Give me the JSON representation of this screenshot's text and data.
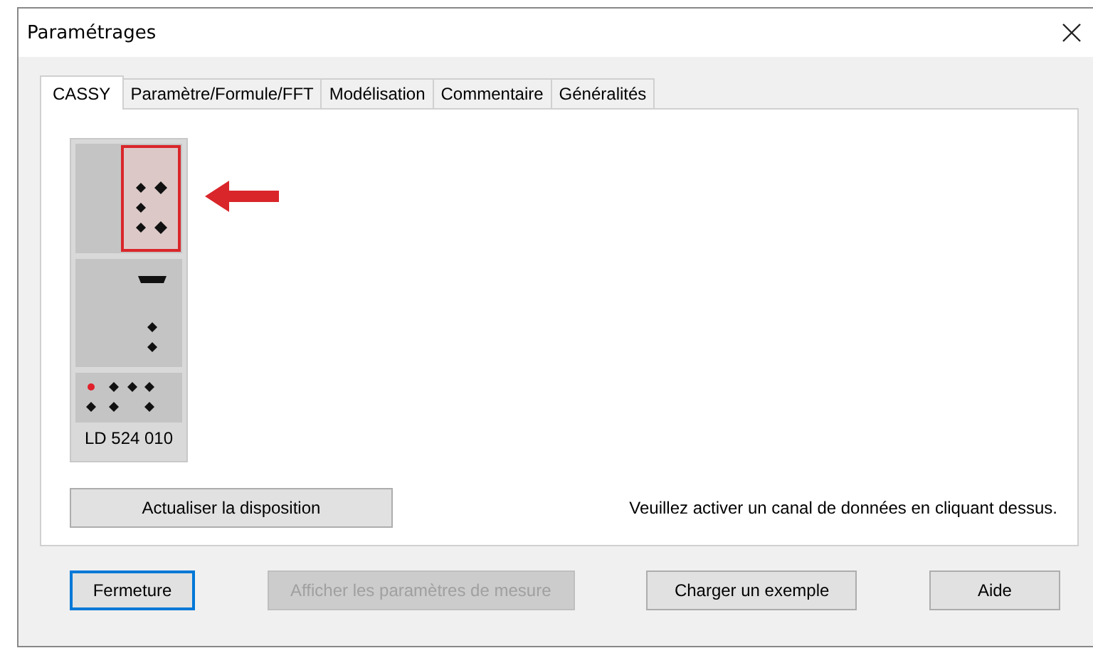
{
  "window": {
    "title": "Paramétrages"
  },
  "tabs": [
    {
      "label": "CASSY",
      "selected": true
    },
    {
      "label": "Paramètre/Formule/FFT",
      "selected": false
    },
    {
      "label": "Modélisation",
      "selected": false
    },
    {
      "label": "Commentaire",
      "selected": false
    },
    {
      "label": "Généralités",
      "selected": false
    }
  ],
  "device": {
    "label": "LD 524 010",
    "slots": [
      {
        "kind": "sensor",
        "highlighted": true
      },
      {
        "kind": "adapter",
        "highlighted": false
      }
    ]
  },
  "refresh_button": {
    "label": "Actualiser la disposition"
  },
  "hint": "Veuillez activer un canal de données en cliquant dessus.",
  "buttons": [
    {
      "label": "Fermeture",
      "disabled": false,
      "default": true
    },
    {
      "label": "Afficher les paramètres de mesure",
      "disabled": true,
      "default": false
    },
    {
      "label": "Charger un exemple",
      "disabled": false,
      "default": false
    },
    {
      "label": "Aide",
      "disabled": false,
      "default": false
    }
  ]
}
